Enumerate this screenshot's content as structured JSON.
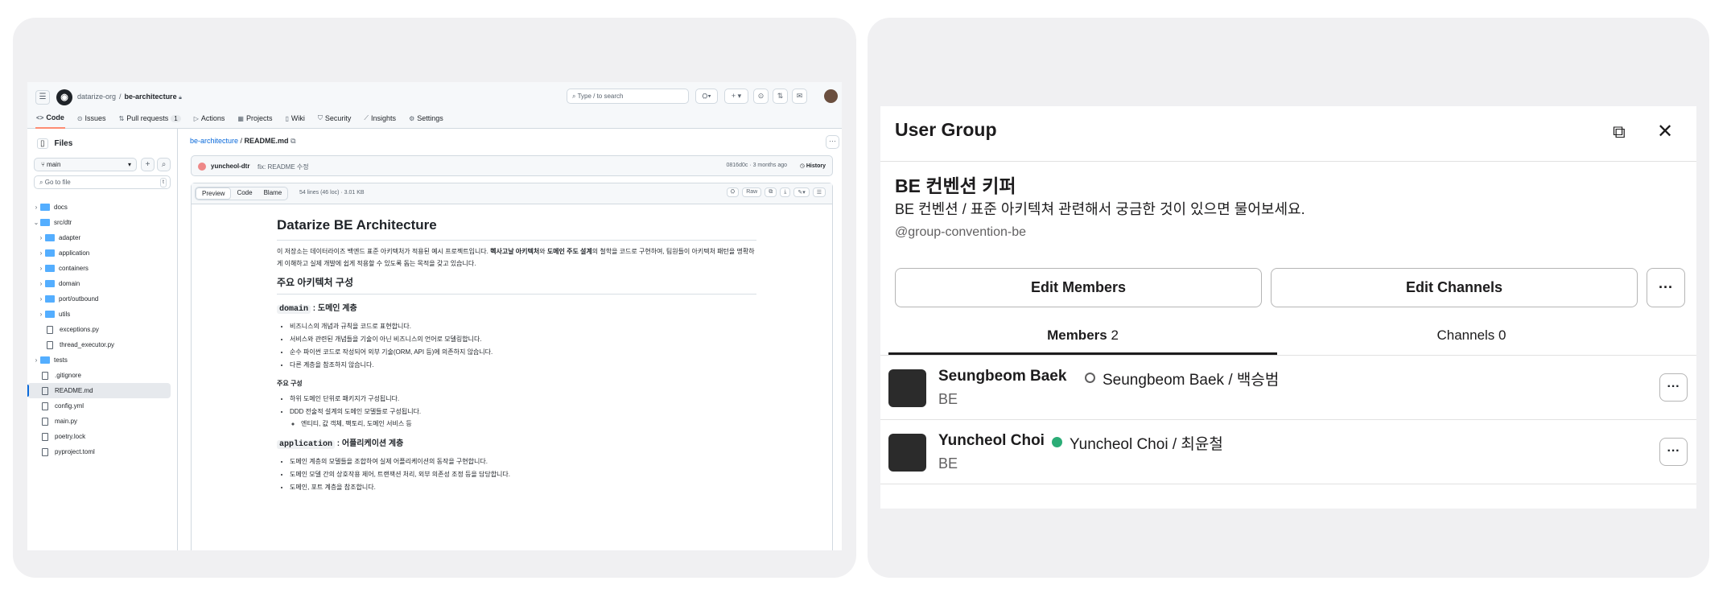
{
  "github": {
    "org": "datarize-org",
    "repo": "be-architecture",
    "search_placeholder": "Type / to search",
    "tabs": [
      {
        "label": "Code",
        "icon": "code-icon"
      },
      {
        "label": "Issues",
        "icon": "issue-icon"
      },
      {
        "label": "Pull requests",
        "icon": "pull-request-icon",
        "count": "1"
      },
      {
        "label": "Actions",
        "icon": "play-icon"
      },
      {
        "label": "Projects",
        "icon": "table-icon"
      },
      {
        "label": "Wiki",
        "icon": "book-icon"
      },
      {
        "label": "Security",
        "icon": "shield-icon"
      },
      {
        "label": "Insights",
        "icon": "graph-icon"
      },
      {
        "label": "Settings",
        "icon": "gear-icon"
      }
    ],
    "sidebar": {
      "title": "Files",
      "branch": "main",
      "goto_placeholder": "Go to file",
      "goto_shortcut": "t",
      "tree": [
        {
          "name": "docs",
          "type": "folder",
          "depth": 0,
          "open": false
        },
        {
          "name": "src/dtr",
          "type": "folder",
          "depth": 0,
          "open": true
        },
        {
          "name": "adapter",
          "type": "folder",
          "depth": 1,
          "open": false
        },
        {
          "name": "application",
          "type": "folder",
          "depth": 1,
          "open": false
        },
        {
          "name": "containers",
          "type": "folder",
          "depth": 1,
          "open": false
        },
        {
          "name": "domain",
          "type": "folder",
          "depth": 1,
          "open": false
        },
        {
          "name": "port/outbound",
          "type": "folder",
          "depth": 1,
          "open": false
        },
        {
          "name": "utils",
          "type": "folder",
          "depth": 1,
          "open": false
        },
        {
          "name": "exceptions.py",
          "type": "file",
          "depth": 1
        },
        {
          "name": "thread_executor.py",
          "type": "file",
          "depth": 1
        },
        {
          "name": "tests",
          "type": "folder",
          "depth": 0,
          "open": false
        },
        {
          "name": ".gitignore",
          "type": "file",
          "depth": 0
        },
        {
          "name": "README.md",
          "type": "file",
          "depth": 0,
          "selected": true
        },
        {
          "name": "config.yml",
          "type": "file",
          "depth": 0
        },
        {
          "name": "main.py",
          "type": "file",
          "depth": 0
        },
        {
          "name": "poetry.lock",
          "type": "file",
          "depth": 0
        },
        {
          "name": "pyproject.toml",
          "type": "file",
          "depth": 0
        }
      ]
    },
    "file": {
      "path_repo": "be-architecture",
      "path_file": "README.md",
      "commit_author": "yuncheol-dtr",
      "commit_msg": "fix: README 수정",
      "commit_meta": "0816d0c · 3 months ago",
      "history": "History",
      "view_modes": [
        "Preview",
        "Code",
        "Blame"
      ],
      "info": "54 lines (46 loc) · 3.01 KB",
      "raw": "Raw"
    },
    "readme": {
      "h1": "Datarize BE Architecture",
      "intro_a": "이 저장소는 데이터라이즈 백엔드 표준 아키텍처가 적용된 예시 프로젝트입니다. ",
      "intro_b1": "헥사고날 아키텍처",
      "intro_c": "와 ",
      "intro_b2": "도메인 주도 설계",
      "intro_d": "의 철학을 코드로 구현하여, 팀원들이 아키텍처 패턴을 명확하게 이해하고 실제 개발에 쉽게 적용할 수 있도록 돕는 목적을 갖고 있습니다.",
      "h2": "주요 아키텍처 구성",
      "domain_code": "domain",
      "domain_title": " : 도메인 계층",
      "domain_items": [
        "비즈니스의 개념과 규칙을 코드로 표현합니다.",
        "서비스와 관련된 개념들을 기술이 아닌 비즈니스의 언어로 모델링합니다.",
        "순수 파이썬 코드로 작성되어 외부 기술(ORM, API 등)에 의존하지 않습니다.",
        "다른 계층을 참조하지 않습니다."
      ],
      "sub_title": "주요 구성",
      "sub_items": [
        "하위 도메인 단위로 패키지가 구성됩니다.",
        "DDD 전술적 설계의 도메인 모델들로 구성됩니다."
      ],
      "sub_nested": "엔티티, 값 객체, 팩토리, 도메인 서비스 등",
      "app_code": "application",
      "app_title": " : 어플리케이션 계층",
      "app_items": [
        "도메인 계층의 모델들을 조합하여 실제 어플리케이션의 동작을 구현합니다.",
        "도메인 모델 간의 상호작용 제어, 트랜잭션 처리, 외부 의존성 조정 등을 담당합니다.",
        "도메인, 포트 계층을 참조합니다."
      ]
    }
  },
  "slack": {
    "title": "User Group",
    "group_name": "BE 컨벤션 키퍼",
    "group_desc": "BE 컨벤션 / 표준 아키텍쳐 관련해서 궁금한 것이 있으면 물어보세요.",
    "handle": "@group-convention-be",
    "edit_members": "Edit Members",
    "edit_channels": "Edit Channels",
    "more": "···",
    "tab_members": "Members",
    "tab_members_count": "2",
    "tab_channels": "Channels",
    "tab_channels_count": "0",
    "members": [
      {
        "name": "Seungbeom Baek",
        "full": "Seungbeom Baek / 백승범",
        "role": "BE",
        "status": "away"
      },
      {
        "name": "Yuncheol Choi",
        "full": "Yuncheol Choi / 최윤철",
        "role": "BE",
        "status": "active"
      }
    ],
    "status_colors": {
      "active": "#2bac76",
      "away": "#616061"
    }
  }
}
